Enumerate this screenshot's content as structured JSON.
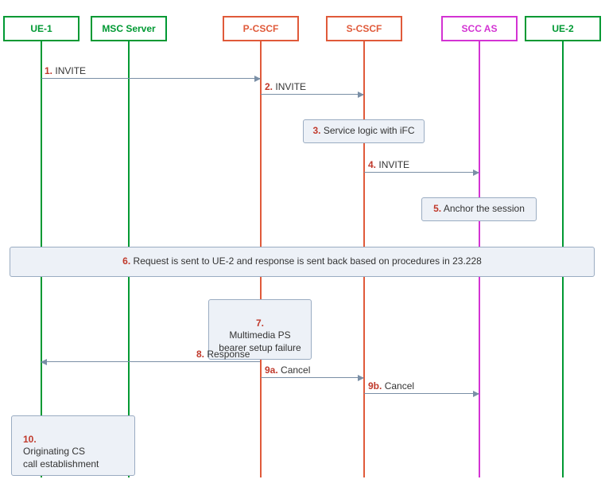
{
  "participants": {
    "ue1": {
      "label": "UE-1"
    },
    "msc": {
      "label": "MSC Server"
    },
    "pcscf": {
      "label": "P-CSCF"
    },
    "scscf": {
      "label": "S-CSCF"
    },
    "sccas": {
      "label": "SCC AS"
    },
    "ue2": {
      "label": "UE-2"
    }
  },
  "steps": {
    "s1": {
      "num": "1.",
      "text": "INVITE"
    },
    "s2": {
      "num": "2.",
      "text": "INVITE"
    },
    "s3": {
      "num": "3.",
      "text": "Service logic with iFC"
    },
    "s4": {
      "num": "4.",
      "text": "INVITE"
    },
    "s5": {
      "num": "5.",
      "text": "Anchor the session"
    },
    "s6": {
      "num": "6.",
      "text": "Request is sent to UE-2 and response is sent back based on procedures in 23.228"
    },
    "s7": {
      "num": "7.",
      "text": "Multimedia PS\nbearer setup failure"
    },
    "s8": {
      "num": "8.",
      "text": "Response"
    },
    "s9a": {
      "num": "9a.",
      "text": "Cancel"
    },
    "s9b": {
      "num": "9b.",
      "text": "Cancel"
    },
    "s10": {
      "num": "10.",
      "text": "Originating CS\ncall establishment"
    }
  }
}
